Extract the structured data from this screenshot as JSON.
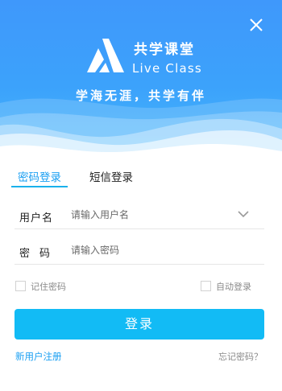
{
  "app": {
    "name": "共学课堂",
    "subtitle": "Live Class",
    "slogan": "学海无涯，共学有伴"
  },
  "icons": {
    "close": "close-icon",
    "logo": "live-class-logo-icon",
    "dropdown": "chevron-down-icon"
  },
  "tabs": [
    {
      "label": "密码登录",
      "active": true
    },
    {
      "label": "短信登录",
      "active": false
    }
  ],
  "form": {
    "username_label": "用户名",
    "username_placeholder": "请输入用户名",
    "username_value": "",
    "password_label": "密码",
    "password_placeholder": "请输入密码",
    "password_value": "",
    "remember_label": "记住密码",
    "remember_checked": false,
    "auto_login_label": "自动登录",
    "auto_login_checked": false,
    "login_button": "登录"
  },
  "links": {
    "register": "新用户注册",
    "forgot": "忘记密码？"
  },
  "colors": {
    "accent": "#1a9ff2",
    "button": "#12bbf5",
    "banner_top": "#3f98fb",
    "banner_bottom": "#45b7fb"
  }
}
